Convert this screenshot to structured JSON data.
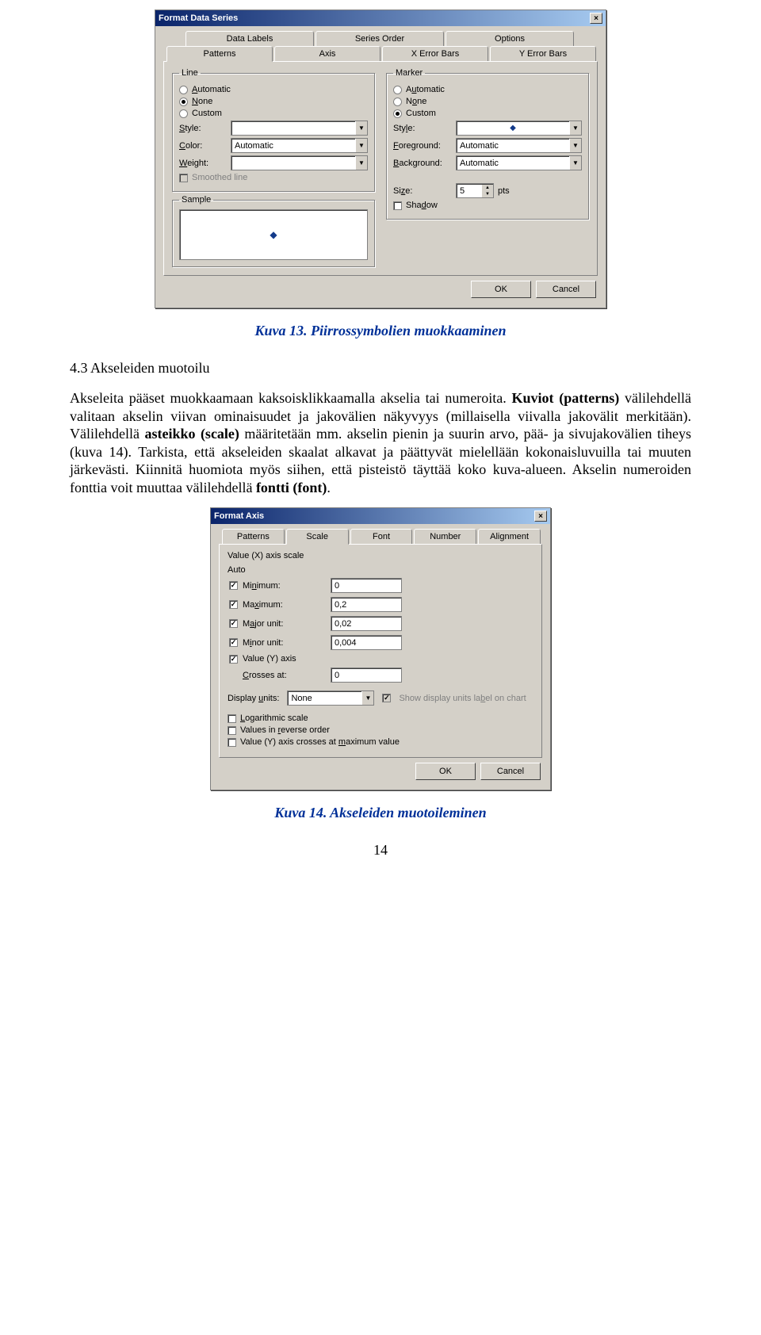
{
  "dialog1": {
    "title": "Format Data Series",
    "tabsTop": [
      "Data Labels",
      "Series Order",
      "Options"
    ],
    "tabsBottom": [
      "Patterns",
      "Axis",
      "X Error Bars",
      "Y Error Bars"
    ],
    "line": {
      "legend": "Line",
      "automatic": "Automatic",
      "none": "None",
      "custom": "Custom",
      "styleLabel": "Style:",
      "colorLabel": "Color:",
      "colorValue": "Automatic",
      "weightLabel": "Weight:",
      "smoothed": "Smoothed line"
    },
    "sample": {
      "legend": "Sample"
    },
    "marker": {
      "legend": "Marker",
      "automatic": "Automatic",
      "none": "None",
      "custom": "Custom",
      "styleLabel": "Style:",
      "fgLabel": "Foreground:",
      "fgValue": "Automatic",
      "bgLabel": "Background:",
      "bgValue": "Automatic",
      "sizeLabel": "Size:",
      "sizeValue": "5",
      "sizeUnit": "pts",
      "shadow": "Shadow"
    },
    "ok": "OK",
    "cancel": "Cancel"
  },
  "caption1": "Kuva 13. Piirrossymbolien muokkaaminen",
  "sectionHeading": "4.3  Akseleiden muotoilu",
  "para1a": "Akseleita pääset muokkaamaan kaksoisklikkaamalla akselia tai numeroita. ",
  "para1term1": "Kuviot (patterns)",
  "para1b": " välilehdellä valitaan akselin viivan ominaisuudet ja jakovälien näkyvyys (millaisella viivalla jakovälit merkitään). Välilehdellä ",
  "para1term2": "asteikko (scale)",
  "para1c": " määritetään mm. akselin pienin ja suurin arvo, pää- ja sivujakovälien tiheys (kuva 14). Tarkista, että akseleiden skaalat alkavat ja päättyvät mielellään kokonaisluvuilla tai muuten järkevästi. Kiinnitä huomiota myös siihen, että pisteistö täyttää koko kuva-alueen. Akselin numeroiden fonttia voit muuttaa välilehdellä ",
  "para1term3": "fontti (font)",
  "para1d": ".",
  "dialog2": {
    "title": "Format Axis",
    "tabs": [
      "Patterns",
      "Scale",
      "Font",
      "Number",
      "Alignment"
    ],
    "scaleTitle": "Value (X) axis scale",
    "auto": "Auto",
    "rows": [
      {
        "label": "Minimum:",
        "value": "0"
      },
      {
        "label": "Maximum:",
        "value": "0,2"
      },
      {
        "label": "Major unit:",
        "value": "0,02"
      },
      {
        "label": "Minor unit:",
        "value": "0,004"
      }
    ],
    "yRowLabel": "Value (Y) axis",
    "crossesLabel": "Crosses at:",
    "crossesValue": "0",
    "displayUnitsLabel": "Display units:",
    "displayUnitsValue": "None",
    "showLabel": "Show display units label on chart",
    "log": "Logarithmic scale",
    "rev": "Values in reverse order",
    "maxCross": "Value (Y) axis crosses at maximum value",
    "ok": "OK",
    "cancel": "Cancel"
  },
  "caption2": "Kuva 14. Akseleiden muotoileminen",
  "pageNumber": "14"
}
